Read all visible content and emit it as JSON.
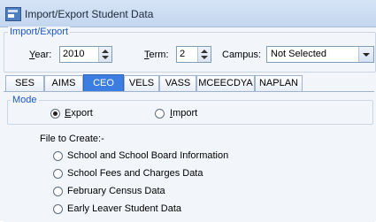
{
  "window": {
    "title": "Import/Export Student Data"
  },
  "import_export": {
    "legend": "Import/Export",
    "year": {
      "label": "Year:",
      "access_key": "Y",
      "value": "2010"
    },
    "term": {
      "label": "Term:",
      "access_key": "T",
      "value": "2"
    },
    "campus": {
      "label": "Campus:",
      "value": "Not Selected"
    }
  },
  "tabs": [
    "SES",
    "AIMS",
    "CEO",
    "VELS",
    "VASS",
    "MCEECDYA",
    "NAPLAN"
  ],
  "mode": {
    "legend": "Mode",
    "export_label": "Export",
    "import_label": "Import",
    "selected": "Export"
  },
  "file_to_create": {
    "heading": "File to Create:-",
    "options": [
      "School and School Board Information",
      "School Fees and Charges Data",
      "February Census Data",
      "Early Leaver Student Data"
    ]
  }
}
